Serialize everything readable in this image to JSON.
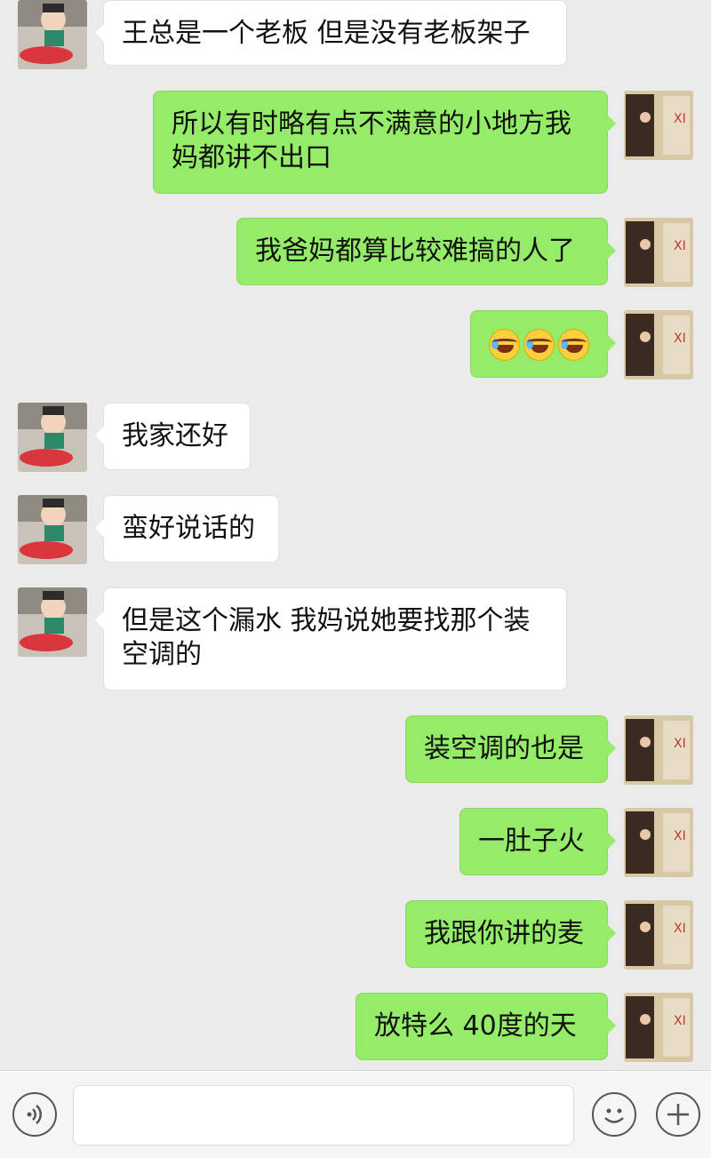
{
  "messages": [
    {
      "side": "left",
      "text": "王总是一个老板 但是没有老板架子"
    },
    {
      "side": "right",
      "text": "所以有时略有点不满意的小地方我妈都讲不出口"
    },
    {
      "side": "right",
      "text": "我爸妈都算比较难搞的人了"
    },
    {
      "side": "right",
      "text": "",
      "emoji": [
        "loudly-crying-face-icon",
        "loudly-crying-face-icon",
        "loudly-crying-face-icon"
      ]
    },
    {
      "side": "left",
      "text": "我家还好"
    },
    {
      "side": "left",
      "text": "蛮好说话的"
    },
    {
      "side": "left",
      "text": "但是这个漏水 我妈说她要找那个装空调的"
    },
    {
      "side": "right",
      "text": "装空调的也是"
    },
    {
      "side": "right",
      "text": "一肚子火"
    },
    {
      "side": "right",
      "text": "我跟你讲的麦"
    },
    {
      "side": "right",
      "text": "放特么 40度的天"
    }
  ],
  "input": {
    "value": "",
    "placeholder": ""
  },
  "colors": {
    "background": "#ebebeb",
    "right_bubble": "#95ec69",
    "left_bubble": "#ffffff"
  },
  "icons": {
    "voice": "voice-icon",
    "emoji": "emoji-icon",
    "plus": "plus-icon"
  }
}
